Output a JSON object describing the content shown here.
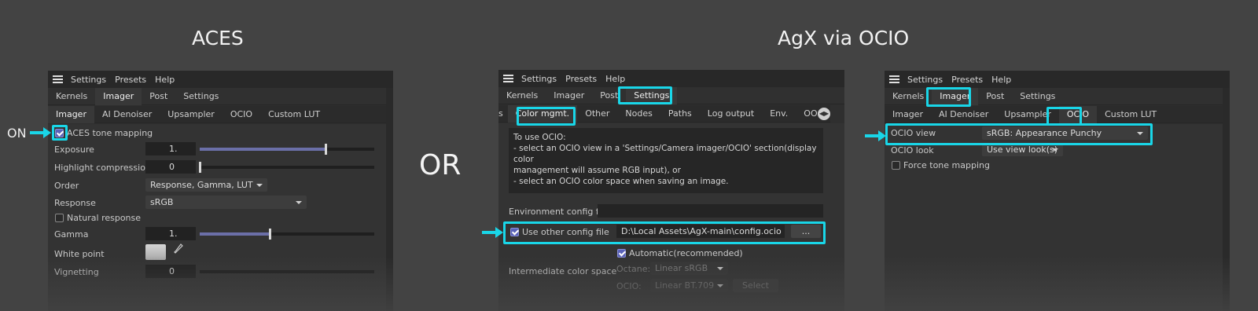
{
  "headings": {
    "aces": "ACES",
    "agx": "AgX via OCIO",
    "or": "OR",
    "on": "ON"
  },
  "menubar": {
    "settings": "Settings",
    "presets": "Presets",
    "help": "Help"
  },
  "main_tabs": {
    "kernels": "Kernels",
    "imager": "Imager",
    "post": "Post",
    "settings": "Settings"
  },
  "imager_tabs": {
    "imager": "Imager",
    "ai_denoiser": "AI Denoiser",
    "upsampler": "Upsampler",
    "ocio": "OCIO",
    "custom_lut": "Custom LUT"
  },
  "aces_panel": {
    "aces_tone_mapping": "ACES tone mapping",
    "exposure_label": "Exposure",
    "exposure_value": "1.",
    "exposure_fraction": 0.72,
    "highlight_label": "Highlight compression",
    "highlight_value": "0",
    "highlight_fraction": 0.0,
    "order_label": "Order",
    "order_value": "Response, Gamma, LUT",
    "response_label": "Response",
    "response_value": "sRGB",
    "natural_response": "Natural response",
    "gamma_label": "Gamma",
    "gamma_value": "1.",
    "gamma_fraction": 0.4,
    "white_point_label": "White point",
    "vignetting_label": "Vignetting",
    "vignetting_value": "0"
  },
  "settings_tabs": {
    "partial": "s",
    "color_mgmt": "Color mgmt.",
    "other": "Other",
    "nodes": "Nodes",
    "paths": "Paths",
    "log_output": "Log output",
    "env": "Env.",
    "ooc": "OOC"
  },
  "settings_panel": {
    "info_line1": "To use OCIO:",
    "info_line2": "- select an OCIO view in a 'Settings/Camera imager/OCIO' section(display color",
    "info_line3": "management will assume RGB input), or",
    "info_line4": "- select an OCIO color space when saving an image.",
    "env_config_label": "Environment config file:",
    "use_other_config": "Use other config file",
    "config_path": "D:\\Local Assets\\AgX-main\\config.ocio",
    "browse_button": "...",
    "automatic": "Automatic(recommended)",
    "intermediate_label": "Intermediate color space",
    "octane_label": "Octane:",
    "octane_value": "Linear sRGB",
    "ocio_label": "OCIO:",
    "ocio_value": "Linear BT.709",
    "select_button": "Select"
  },
  "ocio_panel": {
    "ocio_view_label": "OCIO view",
    "ocio_view_value": "sRGB: Appearance Punchy",
    "ocio_look_label": "OCIO look",
    "ocio_look_value": "Use view look(s)",
    "force_tone_mapping": "Force tone mapping"
  },
  "colors": {
    "highlight": "#19d6e8",
    "slider_fill": "#6b6fa8",
    "checkbox_checked": "#5a62b8"
  }
}
